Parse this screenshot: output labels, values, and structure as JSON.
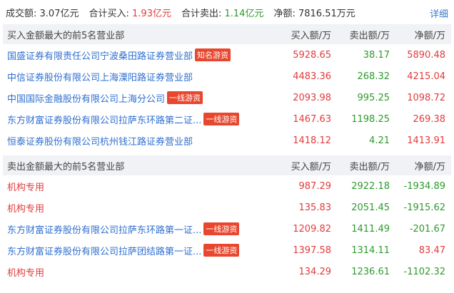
{
  "summary": {
    "turnover_label": "成交额:",
    "turnover_value": "3.07亿元",
    "buy_label": "合计买入:",
    "buy_value": "1.93亿元",
    "sell_label": "合计卖出:",
    "sell_value": "1.14亿元",
    "net_label": "净额:",
    "net_value": "7816.51万元",
    "detail_link": "详细"
  },
  "buy_section": {
    "title": "买入金额最大的前5名营业部",
    "col_buy": "买入额/万",
    "col_sell": "卖出额/万",
    "col_net": "净额/万",
    "rows": [
      {
        "name": "国盛证券有限责任公司宁波桑田路证券营业部",
        "tag": "知名游资",
        "buy": "5928.65",
        "sell": "38.17",
        "net": "5890.48"
      },
      {
        "name": "中信证券股份有限公司上海溧阳路证券营业部",
        "tag": "",
        "buy": "4483.36",
        "sell": "268.32",
        "net": "4215.04"
      },
      {
        "name": "中国国际金融股份有限公司上海分公司",
        "tag": "一线游资",
        "buy": "2093.98",
        "sell": "995.25",
        "net": "1098.72"
      },
      {
        "name": "东方财富证券股份有限公司拉萨东环路第二证...",
        "tag": "一线游资",
        "buy": "1467.63",
        "sell": "1198.25",
        "net": "269.38"
      },
      {
        "name": "恒泰证券股份有限公司杭州钱江路证券营业部",
        "tag": "",
        "buy": "1418.12",
        "sell": "4.21",
        "net": "1413.91"
      }
    ]
  },
  "sell_section": {
    "title": "卖出金额最大的前5名营业部",
    "col_buy": "买入额/万",
    "col_sell": "卖出额/万",
    "col_net": "净额/万",
    "rows": [
      {
        "name": "机构专用",
        "tag": "",
        "buy": "987.29",
        "sell": "2922.18",
        "net": "-1934.89"
      },
      {
        "name": "机构专用",
        "tag": "",
        "buy": "135.83",
        "sell": "2051.45",
        "net": "-1915.62"
      },
      {
        "name": "东方财富证券股份有限公司拉萨东环路第一证...",
        "tag": "一线游资",
        "buy": "1209.82",
        "sell": "1411.49",
        "net": "-201.67"
      },
      {
        "name": "东方财富证券股份有限公司拉萨团结路第一证...",
        "tag": "一线游资",
        "buy": "1397.58",
        "sell": "1314.11",
        "net": "83.47"
      },
      {
        "name": "机构专用",
        "tag": "",
        "buy": "134.29",
        "sell": "1236.61",
        "net": "-1102.32"
      }
    ]
  }
}
